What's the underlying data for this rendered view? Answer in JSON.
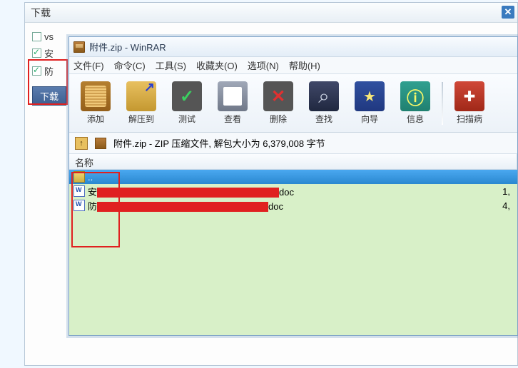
{
  "bg_dialog": {
    "title": "下载",
    "chk1": "vs",
    "chk2": "安",
    "chk3": "防",
    "button": "下载"
  },
  "winrar": {
    "title": "附件.zip - WinRAR",
    "menu": {
      "file": "文件(F)",
      "command": "命令(C)",
      "tools": "工具(S)",
      "favorites": "收藏夹(O)",
      "options": "选项(N)",
      "help": "帮助(H)"
    },
    "toolbar": {
      "add": "添加",
      "extract": "解压到",
      "test": "测试",
      "view": "查看",
      "delete": "删除",
      "find": "查找",
      "wizard": "向导",
      "info": "信息",
      "scan": "扫描病"
    },
    "path": "附件.zip - ZIP 压缩文件, 解包大小为 6,379,008 字节",
    "columns": {
      "name": "名称"
    },
    "files": {
      "parent": "..",
      "f1_prefix": "安",
      "f1_suffix": "doc",
      "f1_size": "1,",
      "f2_prefix": "防",
      "f2_suffix": "doc",
      "f2_size": "4,"
    }
  }
}
